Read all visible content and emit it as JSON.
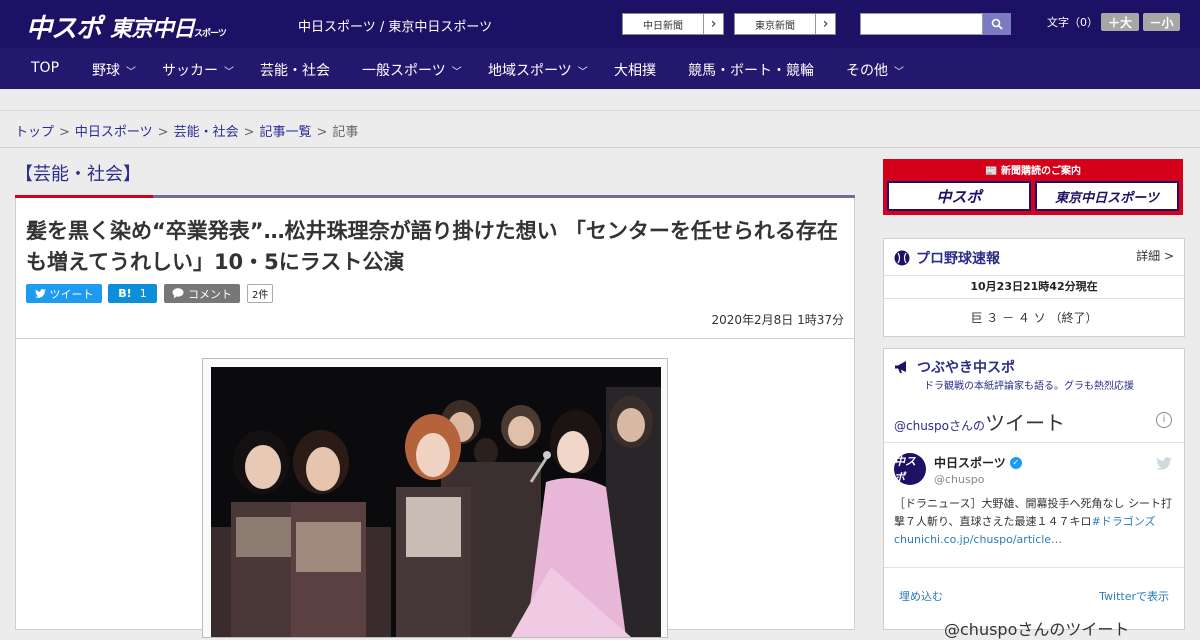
{
  "header": {
    "logo_main": "中スポ",
    "logo_tokyo": "東京中日",
    "logo_tokyo_sub": "スポーツ",
    "site_names": "中日スポーツ / 東京中日スポーツ",
    "paper_buttons": [
      "中日新聞",
      "東京新聞"
    ],
    "search_placeholder": "",
    "font_size_label": "文字（0）",
    "font_bigger": "＋大",
    "font_smaller": "－小"
  },
  "nav": [
    {
      "label": "TOP",
      "has_menu": false
    },
    {
      "label": "野球",
      "has_menu": true
    },
    {
      "label": "サッカー",
      "has_menu": true
    },
    {
      "label": "芸能・社会",
      "has_menu": false
    },
    {
      "label": "一般スポーツ",
      "has_menu": true
    },
    {
      "label": "地域スポーツ",
      "has_menu": true
    },
    {
      "label": "大相撲",
      "has_menu": false
    },
    {
      "label": "競馬・ボート・競輪",
      "has_menu": false
    },
    {
      "label": "その他",
      "has_menu": true
    }
  ],
  "breadcrumb": {
    "links": [
      "トップ",
      "中日スポーツ",
      "芸能・社会",
      "記事一覧"
    ],
    "current": "記事"
  },
  "section": {
    "title": "【芸能・社会】"
  },
  "article": {
    "headline": "髪を黒く染め“卒業発表”…松井珠理奈が語り掛けた想い 「センターを任せられる存在も増えてうれしい」10・5にラスト公演",
    "tweet_label": "ツイート",
    "hatena_label": "B!",
    "hatena_count": "1",
    "comment_label": "コメント",
    "comment_count": "2件",
    "date": "2020年2月8日 1時37分"
  },
  "sidebar": {
    "subscription": {
      "title": "新聞購読のご案内",
      "logos": [
        "中スポ",
        "東京中日スポーツ"
      ]
    },
    "baseball": {
      "title": "プロ野球速報",
      "more": "詳細 >",
      "time": "10月23日21時42分現在",
      "score": "巨 ３ － ４ ソ （終了）"
    },
    "tweets": {
      "title": "つぶやき中スポ",
      "subtitle": "ドラ観戦の本紙評論家も語る。グラも熱烈応援",
      "timeline_user": "@chuspoさんの",
      "timeline_label": "ツイート",
      "user_name": "中日スポーツ",
      "user_handle": "@chuspo",
      "text": "［ドラニュース］大野雄、開幕投手へ死角なし シート打撃７人斬り、直球さえた最速１４７キロ",
      "hashtag": "#ドラゴンズ",
      "link": "chunichi.co.jp/chuspo/article…",
      "embed": "埋め込む",
      "view_on_twitter": "Twitterで表示",
      "bottom": "@chuspoさんのツイート"
    }
  },
  "colors": {
    "header_bg": "#1c1164",
    "nav_bg": "#24186e",
    "accent_red": "#d5001a",
    "tweet_blue": "#1d9bf0",
    "hatena_blue": "#0d8ed9",
    "comment_gray": "#777777"
  }
}
